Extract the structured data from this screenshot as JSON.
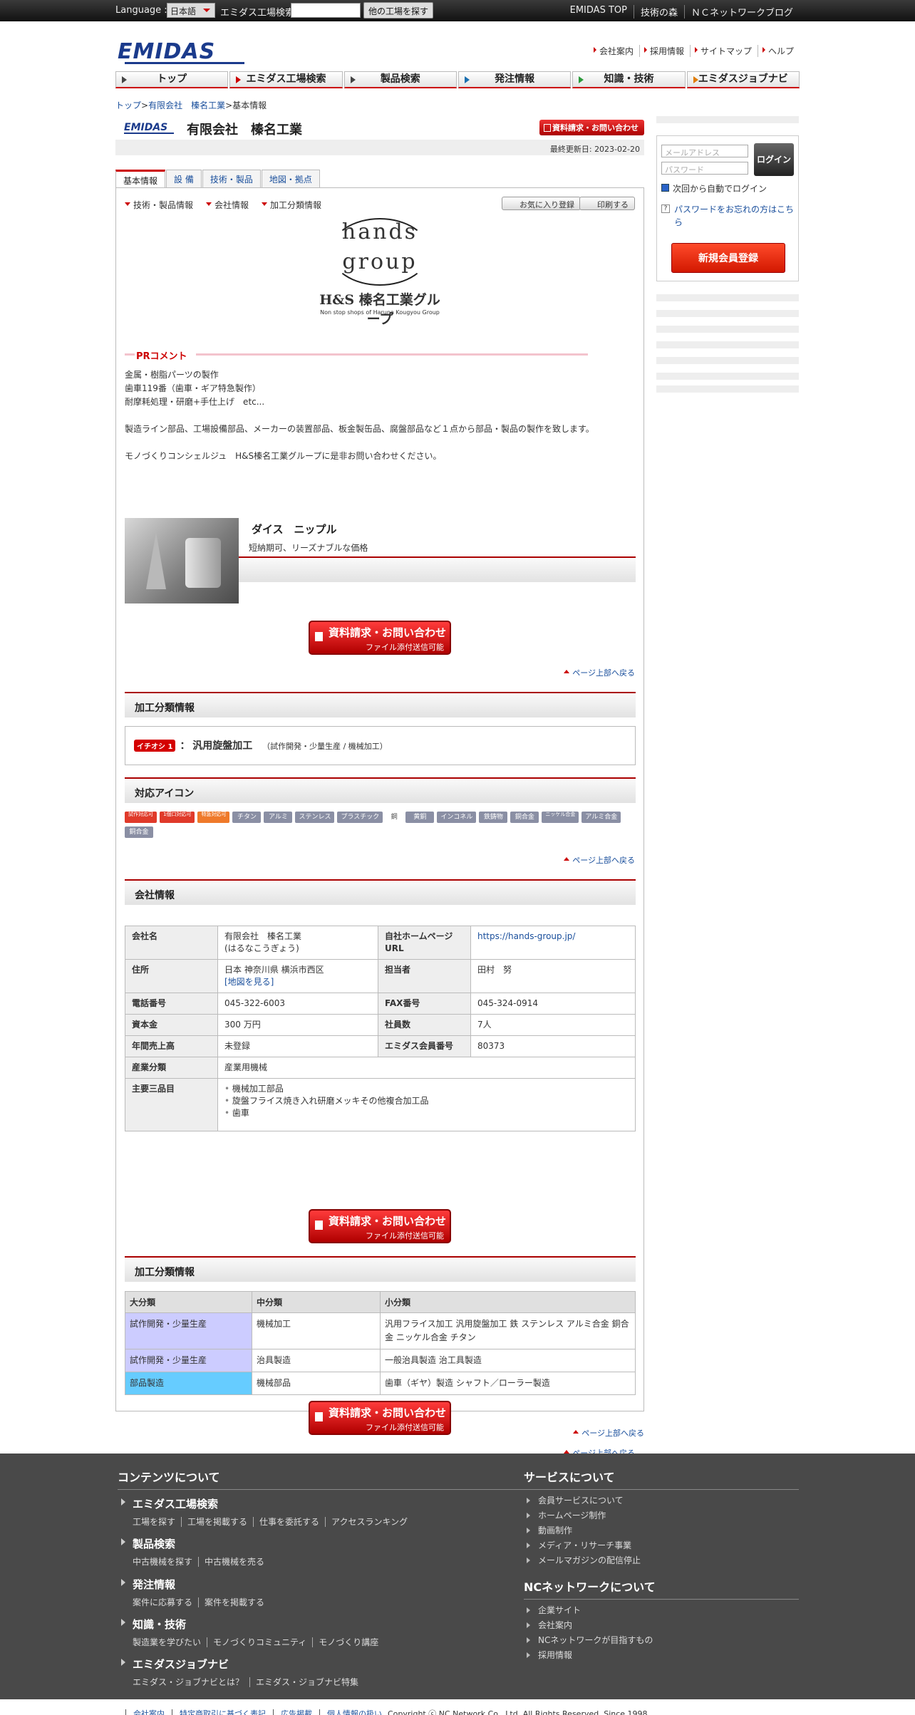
{
  "topbar": {
    "language_label": "Language :",
    "language_value": "日本語",
    "search_label": "エミダス工場検索",
    "search_button": "他の工場を探す",
    "links": [
      "EMIDAS TOP",
      "技術の森",
      "ＮＣネットワークブログ"
    ]
  },
  "header": {
    "logo": "EMIDAS",
    "links": [
      "会社案内",
      "採用情報",
      "サイトマップ",
      "ヘルプ"
    ]
  },
  "gnav": [
    "トップ",
    "エミダス工場検索",
    "製品検索",
    "発注情報",
    "知識・技術",
    "エミダスジョブナビ"
  ],
  "breadcrumb": {
    "items": [
      "トップ",
      "有限会社　榛名工業"
    ],
    "sep": ">",
    "current": "基本情報"
  },
  "company": {
    "mini_logo": "EMIDAS",
    "title": "有限会社　榛名工業",
    "request_button": "資料請求・お問い合わせ",
    "updated_label": "最終更新日:",
    "updated_date": "2023-02-20"
  },
  "tabs": [
    "基本情報",
    "設 備",
    "技術・製品",
    "地図・拠点"
  ],
  "subnav": [
    "技術・製品情報",
    "会社情報",
    "加工分類情報"
  ],
  "actions": {
    "favorite": "お気に入り登録",
    "print": "印刷する"
  },
  "brand": {
    "line1": "hands",
    "line2": "group",
    "line3": "H&S 榛名工業グループ",
    "line4": "Non stop shops of Haruna Kougyou Group"
  },
  "pr": {
    "heading": "PRコメント",
    "text": "金属・樹脂パーツの製作\n歯車119番（歯車・ギア特急製作）\n耐摩耗処理・研磨+手仕上げ　etc...\n\n製造ライン部品、工場設備部品、メーカーの装置部品、板金製缶品、腐盤部品など１点から部品・製品の製作を致します。\n\nモノづくりコンシェルジュ　H&S榛名工業グループに是非お問い合わせください。"
  },
  "tech": {
    "heading": "技術・製品情報",
    "product_name": "ダイス　ニップル",
    "product_desc": "短納期可、リーズナブルな価格"
  },
  "cta": {
    "line1": "資料請求・お問い合わせ",
    "line2": "ファイル添付送信可能"
  },
  "pagetop": "ページ上部へ戻る",
  "process": {
    "heading": "加工分類情報",
    "tag": "イチオシ 1",
    "colon": "：",
    "name": "汎用旋盤加工",
    "sub": "（試作開発・少量生産 / 機械加工）"
  },
  "icons": {
    "heading": "対応アイコン",
    "items": [
      "試作対応可",
      "1個口対応可",
      "特急対応可",
      "チタン",
      "アルミ",
      "ステンレス",
      "プラスチック",
      "鋼",
      "黄銅",
      "インコネル",
      "鉄鋳物",
      "銅合金",
      "ニッケル合金",
      "アルミ合金",
      "銅合金"
    ]
  },
  "info": {
    "heading": "会社情報",
    "company_label": "会社名",
    "company_value": "有限会社　榛名工業",
    "company_kana": "(はるなこうぎょう)",
    "hp_label": "自社ホームページURL",
    "hp_value": "https://hands-group.jp/",
    "address_label": "住所",
    "address_value": "日本 神奈川県 横浜市西区",
    "map_link": "[地図を見る]",
    "person_label": "担当者",
    "person_value": "田村　努",
    "tel_label": "電話番号",
    "tel_value": "045-322-6003",
    "fax_label": "FAX番号",
    "fax_value": "045-324-0914",
    "capital_label": "資本金",
    "capital_value": "300 万円",
    "emp_label": "社員数",
    "emp_value": "7人",
    "sales_label": "年間売上高",
    "sales_value": "未登録",
    "member_label": "エミダス会員番号",
    "member_value": "80373",
    "industry_label": "産業分類",
    "industry_value": "産業用機械",
    "items_label": "主要三品目",
    "items": [
      "機械加工部品",
      "旋盤フライス焼き入れ研磨メッキその他複合加工品",
      "歯車"
    ]
  },
  "proc_table": {
    "heading": "加工分類情報",
    "headers": [
      "大分類",
      "中分類",
      "小分類"
    ],
    "rows": [
      [
        "試作開発・少量生産",
        "機械加工",
        "汎用フライス加工 汎用旋盤加工 鉄 ステンレス アルミ合金 銅合金 ニッケル合金 チタン"
      ],
      [
        "試作開発・少量生産",
        "治具製造",
        "一般治具製造 治工具製造"
      ],
      [
        "部品製造",
        "機械部品",
        "歯車（ギヤ）製造 シャフト／ローラー製造"
      ]
    ]
  },
  "login": {
    "email_placeholder": "メールアドレス",
    "password_placeholder": "パスワード",
    "login_button": "ログイン",
    "auto_login": "次回から自動でログイン",
    "forgot": "パスワードをお忘れの方はこちら",
    "register": "新規会員登録"
  },
  "footer": {
    "contents_heading": "コンテンツについて",
    "groups": [
      {
        "title": "エミダス工場検索",
        "links": [
          "工場を探す",
          "工場を掲載する",
          "仕事を委託する",
          "アクセスランキング"
        ]
      },
      {
        "title": "製品検索",
        "links": [
          "中古機械を探す",
          "中古機械を売る"
        ]
      },
      {
        "title": "発注情報",
        "links": [
          "案件に応募する",
          "案件を掲載する"
        ]
      },
      {
        "title": "知識・技術",
        "links": [
          "製造業を学びたい",
          "モノづくりコミュニティ",
          "モノづくり講座"
        ]
      },
      {
        "title": "エミダスジョブナビ",
        "links": [
          "エミダス・ジョブナビとは？",
          "エミダス・ジョブナビ特集"
        ]
      }
    ],
    "service_heading": "サービスについて",
    "services": [
      "会員サービスについて",
      "ホームページ制作",
      "動画制作",
      "メディア・リサーチ事業",
      "メールマガジンの配信停止"
    ],
    "nc_heading": "NCネットワークについて",
    "nc_links": [
      "企業サイト",
      "会社案内",
      "NCネットワークが目指すもの",
      "採用情報"
    ],
    "bottom_links": [
      "会社案内",
      "特定商取引に基づく表記",
      "広告掲載",
      "個人情報の扱い"
    ],
    "copyright": "Copyright ⓒ NC Network Co., Ltd. All Rights Reserved. Since 1998."
  }
}
